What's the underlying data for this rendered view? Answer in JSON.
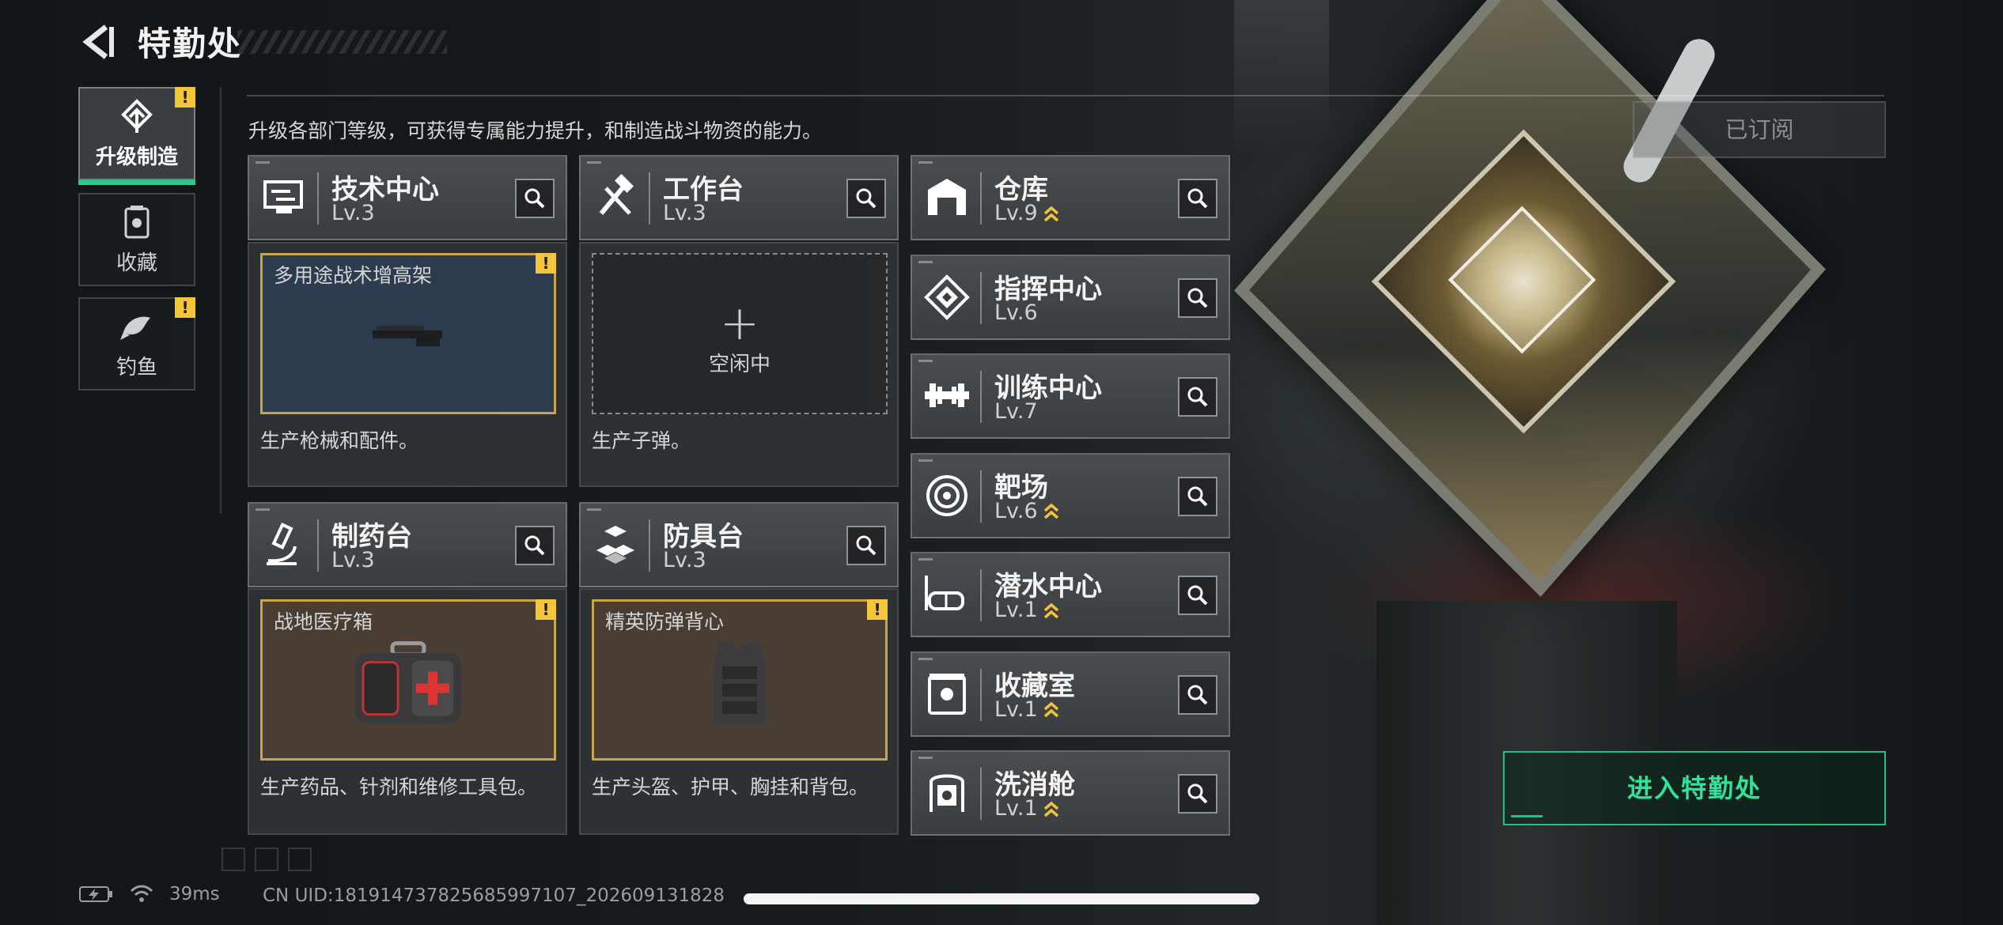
{
  "header": {
    "title": "特勤处",
    "subtitle": "升级各部门等级，可获得专属能力提升，和制造战斗物资的能力。"
  },
  "nav": [
    {
      "label": "升级制造",
      "icon": "upgrade-icon",
      "active": true,
      "alert": "!"
    },
    {
      "label": "收藏",
      "icon": "collection-icon",
      "active": false,
      "alert": ""
    },
    {
      "label": "钓鱼",
      "icon": "fish-icon",
      "active": false,
      "alert": "!"
    }
  ],
  "production": [
    {
      "name": "技术中心",
      "level": "Lv.3",
      "icon": "tech-center-icon",
      "slot_title": "多用途战术增高架",
      "alert": "!",
      "desc": "生产枪械和配件。"
    },
    {
      "name": "工作台",
      "level": "Lv.3",
      "icon": "workbench-icon",
      "slot_plus": "+",
      "slot_idle": "空闲中",
      "desc": "生产子弹。"
    },
    {
      "name": "制药台",
      "level": "Lv.3",
      "icon": "pharmacy-icon",
      "slot_title": "战地医疗箱",
      "alert": "!",
      "desc": "生产药品、针剂和维修工具包。"
    },
    {
      "name": "防具台",
      "level": "Lv.3",
      "icon": "armor-bench-icon",
      "slot_title": "精英防弹背心",
      "alert": "!",
      "desc": "生产头盔、护甲、胸挂和背包。"
    }
  ],
  "facilities": [
    {
      "name": "仓库",
      "level": "Lv.9",
      "upgradable": true,
      "icon": "warehouse-icon"
    },
    {
      "name": "指挥中心",
      "level": "Lv.6",
      "upgradable": false,
      "icon": "command-center-icon"
    },
    {
      "name": "训练中心",
      "level": "Lv.7",
      "upgradable": false,
      "icon": "training-center-icon"
    },
    {
      "name": "靶场",
      "level": "Lv.6",
      "upgradable": true,
      "icon": "shooting-range-icon"
    },
    {
      "name": "潜水中心",
      "level": "Lv.1",
      "upgradable": true,
      "icon": "diving-center-icon"
    },
    {
      "name": "收藏室",
      "level": "Lv.1",
      "upgradable": true,
      "icon": "collection-room-icon"
    },
    {
      "name": "洗消舱",
      "level": "Lv.1",
      "upgradable": true,
      "icon": "decontamination-icon"
    }
  ],
  "subscribed_label": "已订阅",
  "enter_label": "进入特勤处",
  "status": {
    "ping": "39ms",
    "uid": "CN UID:18191473782568599710​7_202609131828"
  },
  "colors": {
    "accent_green": "#1fd18a",
    "alert_yellow": "#f4c53a",
    "slot_border": "#c9a54a"
  }
}
